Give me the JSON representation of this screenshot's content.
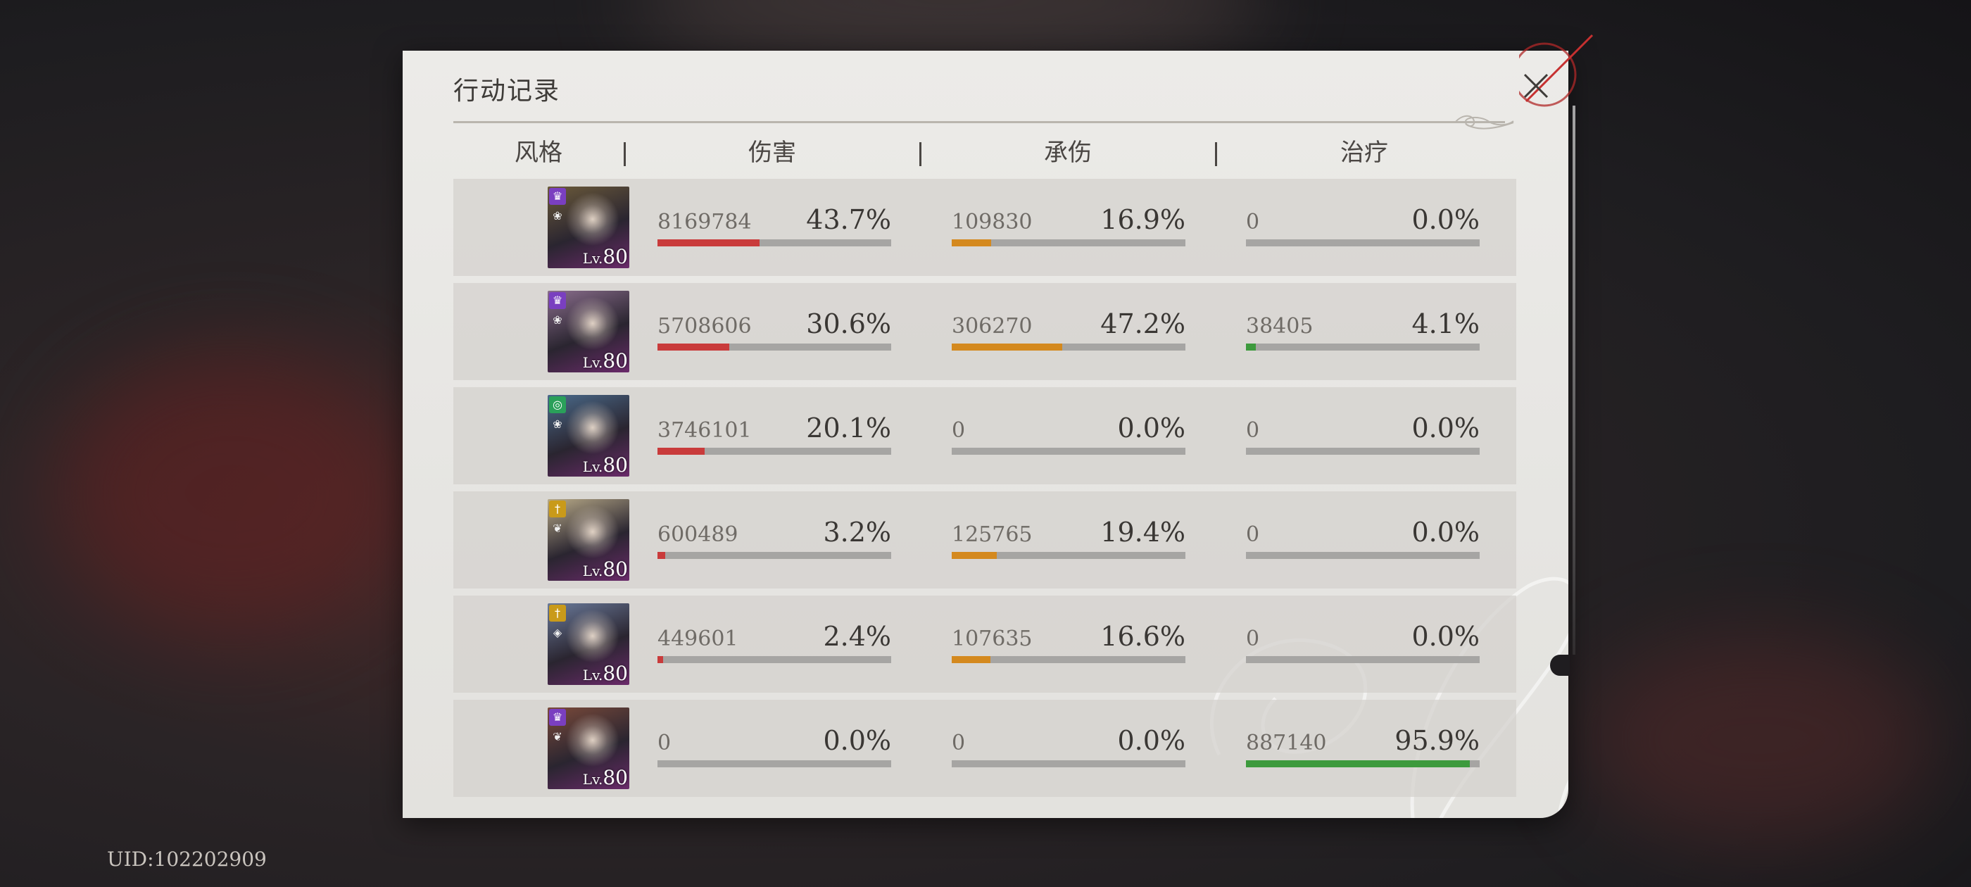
{
  "panel": {
    "title": "行动记录",
    "close_icon": "close-icon"
  },
  "columns": [
    "风格",
    "伤害",
    "承伤",
    "治疗"
  ],
  "colors": {
    "damage": "#c93b3b",
    "taken": "#d4891e",
    "heal": "#3d9a3d",
    "track": "#a6a5a3"
  },
  "rows": [
    {
      "portrait": {
        "level_prefix": "Lv.",
        "level": "80",
        "badge": "crown-icon",
        "badge_color": "#7a3fc0",
        "sub_icon": "lotus-icon",
        "hue": "#6b5a3a"
      },
      "damage": {
        "value": "8169784",
        "percent": "43.7%",
        "fraction": 0.437
      },
      "taken": {
        "value": "109830",
        "percent": "16.9%",
        "fraction": 0.169
      },
      "heal": {
        "value": "0",
        "percent": "0.0%",
        "fraction": 0.0
      }
    },
    {
      "portrait": {
        "level_prefix": "Lv.",
        "level": "80",
        "badge": "crown-icon",
        "badge_color": "#7a3fc0",
        "sub_icon": "lotus-icon",
        "hue": "#8a6d8c"
      },
      "damage": {
        "value": "5708606",
        "percent": "30.6%",
        "fraction": 0.306
      },
      "taken": {
        "value": "306270",
        "percent": "47.2%",
        "fraction": 0.472
      },
      "heal": {
        "value": "38405",
        "percent": "4.1%",
        "fraction": 0.041
      }
    },
    {
      "portrait": {
        "level_prefix": "Lv.",
        "level": "80",
        "badge": "swirl-icon",
        "badge_color": "#2aa05a",
        "sub_icon": "lotus-icon",
        "hue": "#4a6a8a"
      },
      "damage": {
        "value": "3746101",
        "percent": "20.1%",
        "fraction": 0.201
      },
      "taken": {
        "value": "0",
        "percent": "0.0%",
        "fraction": 0.0
      },
      "heal": {
        "value": "0",
        "percent": "0.0%",
        "fraction": 0.0
      }
    },
    {
      "portrait": {
        "level_prefix": "Lv.",
        "level": "80",
        "badge": "sword-icon",
        "badge_color": "#c99a1a",
        "sub_icon": "wing-icon",
        "hue": "#b8aa88"
      },
      "damage": {
        "value": "600489",
        "percent": "3.2%",
        "fraction": 0.032
      },
      "taken": {
        "value": "125765",
        "percent": "19.4%",
        "fraction": 0.194
      },
      "heal": {
        "value": "0",
        "percent": "0.0%",
        "fraction": 0.0
      }
    },
    {
      "portrait": {
        "level_prefix": "Lv.",
        "level": "80",
        "badge": "sword-icon",
        "badge_color": "#c99a1a",
        "sub_icon": "shield-icon",
        "hue": "#6a7a9a"
      },
      "damage": {
        "value": "449601",
        "percent": "2.4%",
        "fraction": 0.024
      },
      "taken": {
        "value": "107635",
        "percent": "16.6%",
        "fraction": 0.166
      },
      "heal": {
        "value": "0",
        "percent": "0.0%",
        "fraction": 0.0
      }
    },
    {
      "portrait": {
        "level_prefix": "Lv.",
        "level": "80",
        "badge": "crown-icon",
        "badge_color": "#7a3fc0",
        "sub_icon": "wing-icon",
        "hue": "#7a4a3a"
      },
      "damage": {
        "value": "0",
        "percent": "0.0%",
        "fraction": 0.0
      },
      "taken": {
        "value": "0",
        "percent": "0.0%",
        "fraction": 0.0
      },
      "heal": {
        "value": "887140",
        "percent": "95.9%",
        "fraction": 0.959
      }
    }
  ],
  "footer": {
    "uid": "UID:102202909"
  }
}
